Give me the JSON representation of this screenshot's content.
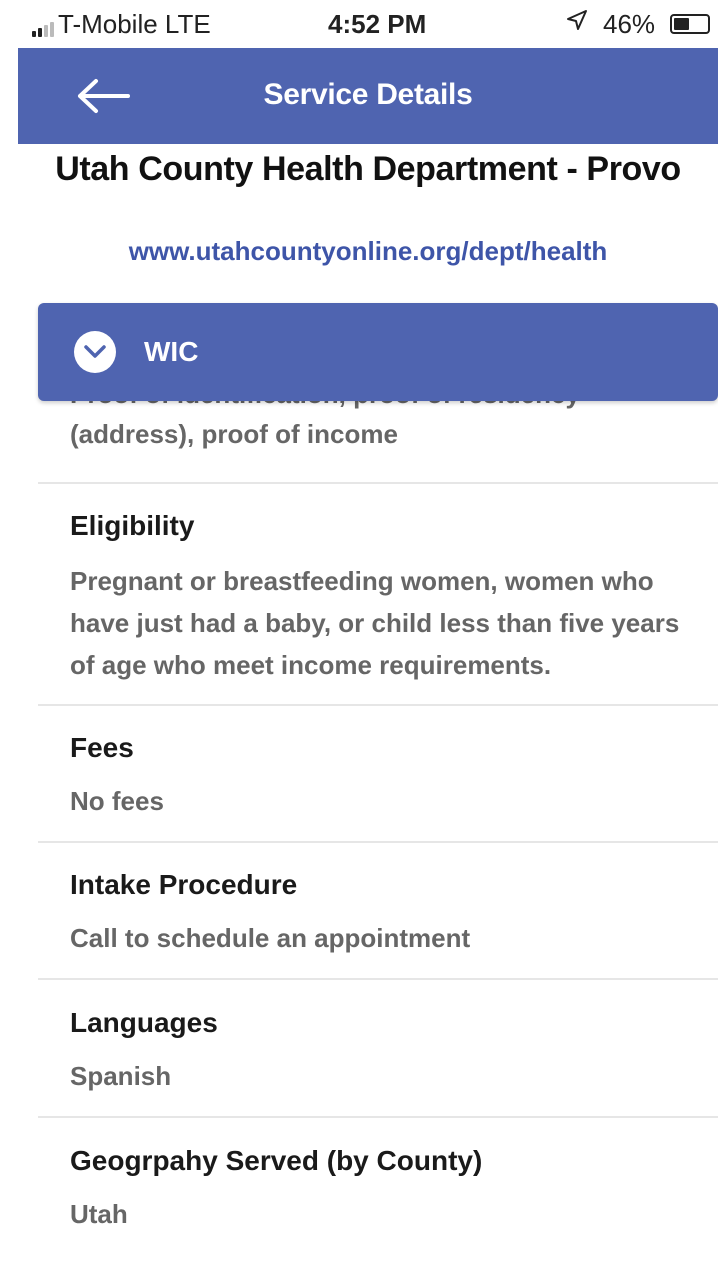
{
  "status_bar": {
    "carrier": "T-Mobile  LTE",
    "time": "4:52 PM",
    "battery": "46%",
    "battery_level": 0.46,
    "location_icon": "location-arrow-icon"
  },
  "nav": {
    "title": "Service Details",
    "back_icon": "back-arrow-icon"
  },
  "org": {
    "name": "Utah County Health Department - Provo",
    "website": "www.utahcountyonline.org/dept/health"
  },
  "section": {
    "label": "WIC",
    "icon": "chevron-down-circle-icon"
  },
  "details": {
    "clipped_top_line": "Proof of identification, proof of residency",
    "clipped_value": "(address), proof of income",
    "eligibility": {
      "heading": "Eligibility",
      "value": "Pregnant or breastfeeding women, women who have just had a baby, or child less than five years of age who meet income requirements."
    },
    "fees": {
      "heading": "Fees",
      "value": "No fees"
    },
    "intake": {
      "heading": "Intake Procedure",
      "value": "Call to schedule an appointment"
    },
    "languages": {
      "heading": "Languages",
      "value": "Spanish"
    },
    "geography": {
      "heading": "Geogrpahy Served (by County)",
      "value": "Utah"
    }
  },
  "colors": {
    "primary": "#4f64b0",
    "link": "#3e55a8",
    "muted_text": "#666666"
  }
}
